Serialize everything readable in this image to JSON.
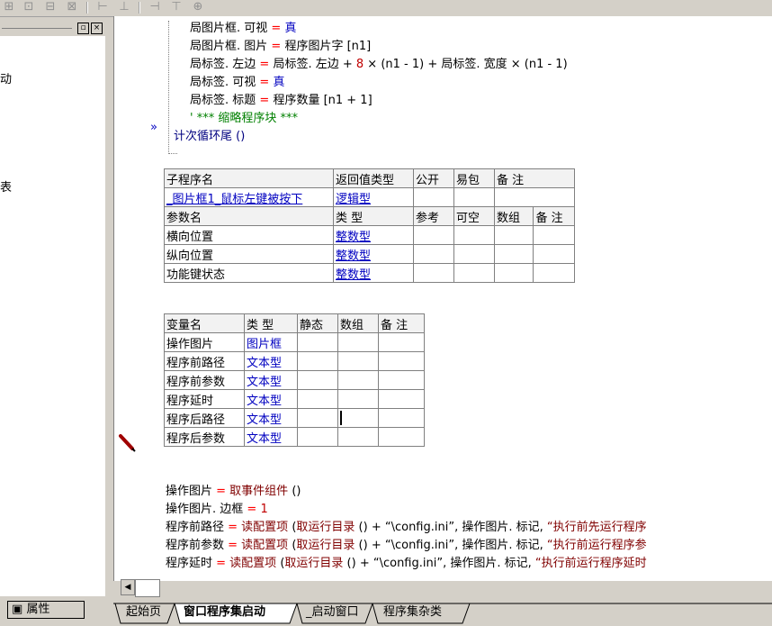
{
  "left_panel": {
    "title_buttons": [
      "▫",
      "×"
    ],
    "partial_texts": [
      "动",
      "表"
    ],
    "props_tab_label": "属性"
  },
  "code_top": [
    {
      "parts": [
        [
          "局图片框. 可视 ",
          ""
        ],
        [
          "= ",
          "op"
        ],
        [
          "真",
          "kw"
        ]
      ]
    },
    {
      "parts": [
        [
          "局图片框. 图片 ",
          ""
        ],
        [
          "= ",
          "op"
        ],
        [
          "程序图片字 [n1]",
          ""
        ]
      ]
    },
    {
      "parts": [
        [
          "局标签. 左边 ",
          ""
        ],
        [
          "= ",
          "op"
        ],
        [
          "局标签. 左边 + ",
          ""
        ],
        [
          "8",
          "num"
        ],
        [
          " × (n1 - 1) + 局标签. 宽度 × (n1 - 1)",
          ""
        ]
      ]
    },
    {
      "parts": [
        [
          "局标签. 可视 ",
          ""
        ],
        [
          "= ",
          "op"
        ],
        [
          "真",
          "kw"
        ]
      ]
    },
    {
      "parts": [
        [
          "局标签. 标题 ",
          ""
        ],
        [
          "= ",
          "op"
        ],
        [
          "程序数量 [n1 + 1]",
          ""
        ]
      ]
    },
    {
      "parts": [
        [
          "' *** 缩略程序块 ***",
          "cmt"
        ]
      ]
    },
    {
      "parts": [
        [
          "计次循环尾 ()",
          "sym"
        ]
      ]
    }
  ],
  "sub_table": {
    "header1": [
      "子程序名",
      "返回值类型",
      "公开",
      "易包",
      "备 注"
    ],
    "row1": [
      "_图片框1_鼠标左键被按下",
      "逻辑型",
      "",
      "",
      ""
    ],
    "header2": [
      "参数名",
      "类 型",
      "参考",
      "可空",
      "数组",
      "备 注"
    ],
    "params": [
      [
        "横向位置",
        "整数型"
      ],
      [
        "纵向位置",
        "整数型"
      ],
      [
        "功能键状态",
        "整数型"
      ]
    ]
  },
  "var_table": {
    "header": [
      "变量名",
      "类 型",
      "静态",
      "数组",
      "备 注"
    ],
    "rows": [
      [
        "操作图片",
        "图片框"
      ],
      [
        "程序前路径",
        "文本型"
      ],
      [
        "程序前参数",
        "文本型"
      ],
      [
        "程序延时",
        "文本型"
      ],
      [
        "程序后路径",
        "文本型"
      ],
      [
        "程序后参数",
        "文本型"
      ]
    ]
  },
  "code_bottom": [
    {
      "parts": [
        [
          "操作图片 ",
          ""
        ],
        [
          "= ",
          "op"
        ],
        [
          "取事件组件",
          "fn"
        ],
        [
          " ()",
          ""
        ]
      ]
    },
    {
      "parts": [
        [
          "操作图片. 边框 ",
          ""
        ],
        [
          "= ",
          "op"
        ],
        [
          "1",
          "num"
        ]
      ]
    },
    {
      "parts": [
        [
          "程序前路径 ",
          ""
        ],
        [
          "= ",
          "op"
        ],
        [
          "读配置项",
          "fn"
        ],
        [
          " (",
          ""
        ],
        [
          "取运行目录",
          "fn"
        ],
        [
          " () + “\\config.ini”, 操作图片. 标记, ",
          ""
        ],
        [
          "“执行前先运行程序",
          "fn"
        ]
      ]
    },
    {
      "parts": [
        [
          "程序前参数 ",
          ""
        ],
        [
          "= ",
          "op"
        ],
        [
          "读配置项",
          "fn"
        ],
        [
          " (",
          ""
        ],
        [
          "取运行目录",
          "fn"
        ],
        [
          " () + “\\config.ini”, 操作图片. 标记, ",
          ""
        ],
        [
          "“执行前运行程序参",
          "fn"
        ]
      ]
    },
    {
      "parts": [
        [
          "程序延时 ",
          ""
        ],
        [
          "= ",
          "op"
        ],
        [
          "读配置项",
          "fn"
        ],
        [
          " (",
          ""
        ],
        [
          "取运行目录",
          "fn"
        ],
        [
          " () + “\\config.ini”, 操作图片. 标记, ",
          ""
        ],
        [
          "“执行前运行程序延时",
          "fn"
        ]
      ]
    }
  ],
  "bottom_tabs": [
    "起始页",
    "窗口程序集启动",
    "_启动窗口",
    "程序集杂类"
  ],
  "active_tab": "窗口程序集启动",
  "colors": {
    "keyword": "#0000c0",
    "operator": "#ff0000",
    "comment": "#008000",
    "function": "#800000",
    "number": "#c00000"
  }
}
